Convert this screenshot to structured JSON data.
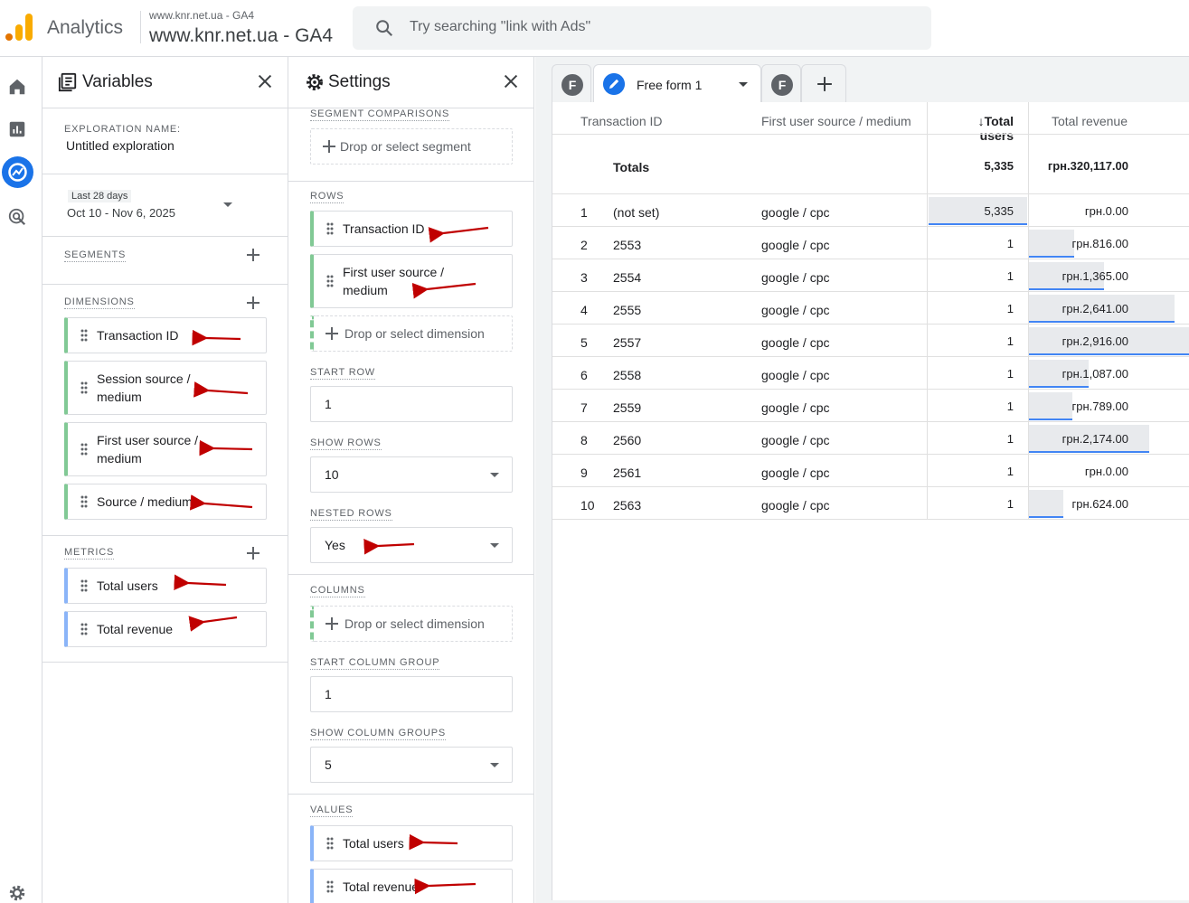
{
  "topbar": {
    "app_name": "Analytics",
    "account_small": "www.knr.net.ua - GA4",
    "account_big": "www.knr.net.ua - GA4",
    "search_placeholder": "Try searching \"link with Ads\""
  },
  "variables": {
    "title": "Variables",
    "exploration_label": "EXPLORATION NAME:",
    "exploration_name": "Untitled exploration",
    "date_range_label": "Last 28 days",
    "date_range": "Oct 10 - Nov 6, 2025",
    "segments_label": "SEGMENTS",
    "dimensions_label": "DIMENSIONS",
    "dimensions": [
      {
        "line1": "Transaction ID",
        "line2": ""
      },
      {
        "line1": "Session source /",
        "line2": "medium"
      },
      {
        "line1": "First user source /",
        "line2": "medium"
      },
      {
        "line1": "Source / medium",
        "line2": ""
      }
    ],
    "metrics_label": "METRICS",
    "metrics": [
      "Total users",
      "Total revenue"
    ]
  },
  "settings": {
    "title": "Settings",
    "segment_comparisons_label": "SEGMENT COMPARISONS",
    "drop_segment": "Drop or select segment",
    "rows_label": "ROWS",
    "rows": [
      {
        "line1": "Transaction ID",
        "line2": ""
      },
      {
        "line1": "First user source /",
        "line2": "medium"
      }
    ],
    "drop_dimension": "Drop or select dimension",
    "start_row_label": "START ROW",
    "start_row": "1",
    "show_rows_label": "SHOW ROWS",
    "show_rows": "10",
    "nested_rows_label": "NESTED ROWS",
    "nested_rows": "Yes",
    "columns_label": "COLUMNS",
    "start_column_group_label": "START COLUMN GROUP",
    "start_column_group": "1",
    "show_column_groups_label": "SHOW COLUMN GROUPS",
    "show_column_groups": "5",
    "values_label": "VALUES",
    "values": [
      "Total users",
      "Total revenue"
    ]
  },
  "tabs": {
    "f_letter": "F",
    "active_tab": "Free form 1"
  },
  "table": {
    "headers": [
      "Transaction ID",
      "First user source / medium",
      "Total users",
      "Total revenue"
    ],
    "totals_label": "Totals",
    "totals_users": "5,335",
    "totals_revenue": "грн.320,117.00",
    "rows": [
      {
        "n": "1",
        "id": "(not set)",
        "source": "google / cpc",
        "users": "5,335",
        "revenue": "грн.0.00",
        "rev_value": 0
      },
      {
        "n": "2",
        "id": "2553",
        "source": "google / cpc",
        "users": "1",
        "revenue": "грн.816.00",
        "rev_value": 816
      },
      {
        "n": "3",
        "id": "2554",
        "source": "google / cpc",
        "users": "1",
        "revenue": "грн.1,365.00",
        "rev_value": 1365
      },
      {
        "n": "4",
        "id": "2555",
        "source": "google / cpc",
        "users": "1",
        "revenue": "грн.2,641.00",
        "rev_value": 2641
      },
      {
        "n": "5",
        "id": "2557",
        "source": "google / cpc",
        "users": "1",
        "revenue": "грн.2,916.00",
        "rev_value": 2916
      },
      {
        "n": "6",
        "id": "2558",
        "source": "google / cpc",
        "users": "1",
        "revenue": "грн.1,087.00",
        "rev_value": 1087
      },
      {
        "n": "7",
        "id": "2559",
        "source": "google / cpc",
        "users": "1",
        "revenue": "грн.789.00",
        "rev_value": 789
      },
      {
        "n": "8",
        "id": "2560",
        "source": "google / cpc",
        "users": "1",
        "revenue": "грн.2,174.00",
        "rev_value": 2174
      },
      {
        "n": "9",
        "id": "2561",
        "source": "google / cpc",
        "users": "1",
        "revenue": "грн.0.00",
        "rev_value": 0
      },
      {
        "n": "10",
        "id": "2563",
        "source": "google / cpc",
        "users": "1",
        "revenue": "грн.624.00",
        "rev_value": 624
      }
    ]
  }
}
